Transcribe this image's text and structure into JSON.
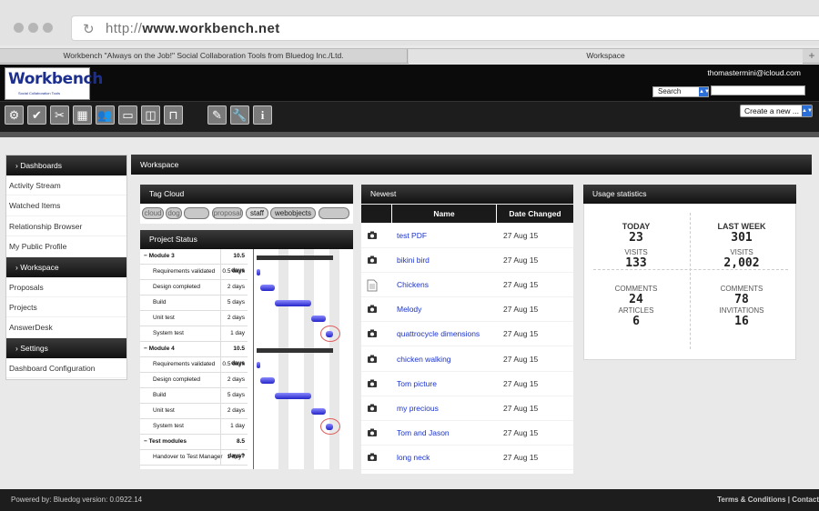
{
  "browser": {
    "url_prefix": "http://",
    "url_host": "www.workbench.net",
    "tabs": [
      {
        "label": "Workbench \"Always on the Job!\" Social Collaboration Tools from Bluedog Inc./Ltd."
      },
      {
        "label": "Workspace"
      }
    ]
  },
  "header": {
    "logo_text": "Workbench",
    "logo_sub": "Social Collaboration Tools",
    "user_email": "thomastermini@icloud.com",
    "search_select": "Search",
    "search_value": "",
    "create_label": "Create a new ..."
  },
  "toolbar": {
    "icons": [
      "settings-icon",
      "check-icon",
      "tools-icon",
      "calendar-icon",
      "people-icon",
      "document-icon",
      "layout-icon",
      "workflow-icon",
      "pencil-icon",
      "wrench-icon",
      "info-icon"
    ]
  },
  "sidebar": {
    "sections": [
      {
        "head": "› Dashboards",
        "items": [
          "Activity Stream",
          "Watched Items",
          "Relationship Browser",
          "My Public Profile"
        ]
      },
      {
        "head": "› Workspace",
        "items": [
          "Proposals",
          "Projects",
          "AnswerDesk"
        ]
      },
      {
        "head": "› Settings",
        "items": [
          "Dashboard Configuration"
        ]
      }
    ]
  },
  "workspace": {
    "title": "Workspace",
    "tag_cloud": {
      "title": "Tag Cloud",
      "tags": [
        "cloud",
        "dog",
        "",
        "proposal",
        "staff",
        "webobjects",
        ""
      ]
    },
    "project_status": {
      "title": "Project Status",
      "tasks": [
        {
          "name": "Module 3",
          "duration": "10.5 days",
          "summary": true,
          "start": 0,
          "end": 10.5
        },
        {
          "name": "Requirements validated",
          "duration": "0.5 days",
          "start": 0,
          "end": 0.5
        },
        {
          "name": "Design completed",
          "duration": "2 days",
          "start": 0.5,
          "end": 2.5
        },
        {
          "name": "Build",
          "duration": "5 days",
          "start": 2.5,
          "end": 7.5
        },
        {
          "name": "Unit test",
          "duration": "2 days",
          "start": 7.5,
          "end": 9.5
        },
        {
          "name": "System test",
          "duration": "1 day",
          "start": 9.5,
          "end": 10.5
        },
        {
          "name": "Module 4",
          "duration": "10.5 days",
          "summary": true,
          "start": 0,
          "end": 10.5
        },
        {
          "name": "Requirements validated",
          "duration": "0.5 days",
          "start": 0,
          "end": 0.5
        },
        {
          "name": "Design completed",
          "duration": "2 days",
          "start": 0.5,
          "end": 2.5
        },
        {
          "name": "Build",
          "duration": "5 days",
          "start": 2.5,
          "end": 7.5
        },
        {
          "name": "Unit test",
          "duration": "2 days",
          "start": 7.5,
          "end": 9.5
        },
        {
          "name": "System test",
          "duration": "1 day",
          "start": 9.5,
          "end": 10.5
        },
        {
          "name": "Test modules",
          "duration": "8.5 days?",
          "summary": true
        },
        {
          "name": "Handover to Test Manager",
          "duration": "1 day?"
        }
      ]
    },
    "newest": {
      "title": "Newest",
      "col_name": "Name",
      "col_date": "Date Changed",
      "rows": [
        {
          "icon": "camera-icon",
          "name": "test PDF",
          "date": "27 Aug 15"
        },
        {
          "icon": "camera-icon",
          "name": "bikini bird",
          "date": "27 Aug 15"
        },
        {
          "icon": "document-icon",
          "name": "Chickens",
          "date": "27 Aug 15"
        },
        {
          "icon": "camera-icon",
          "name": "Melody",
          "date": "27 Aug 15"
        },
        {
          "icon": "camera-icon",
          "name": "quattrocycle dimensions",
          "date": "27 Aug 15"
        },
        {
          "icon": "camera-icon",
          "name": "chicken walking",
          "date": "27 Aug 15"
        },
        {
          "icon": "camera-icon",
          "name": "Tom picture",
          "date": "27 Aug 15"
        },
        {
          "icon": "camera-icon",
          "name": "my precious",
          "date": "27 Aug 15"
        },
        {
          "icon": "camera-icon",
          "name": "Tom and Jason",
          "date": "27 Aug 15"
        },
        {
          "icon": "camera-icon",
          "name": "long neck",
          "date": "27 Aug 15"
        }
      ]
    },
    "usage": {
      "title": "Usage statistics",
      "today_label": "TODAY",
      "today_value": "23",
      "lastweek_label": "LAST WEEK",
      "lastweek_value": "301",
      "visits_label": "VISITS",
      "visits_today": "133",
      "visits_week": "2,002",
      "comments_label": "COMMENTS",
      "comments_today": "24",
      "comments_week": "78",
      "articles_label": "ARTICLES",
      "articles_today": "6",
      "invitations_label": "INVITATIONS",
      "invitations_week": "16"
    }
  },
  "footer": {
    "powered": "Powered by: Bluedog version: 0.0922.14",
    "links": "Terms & Conditions | Contact"
  }
}
